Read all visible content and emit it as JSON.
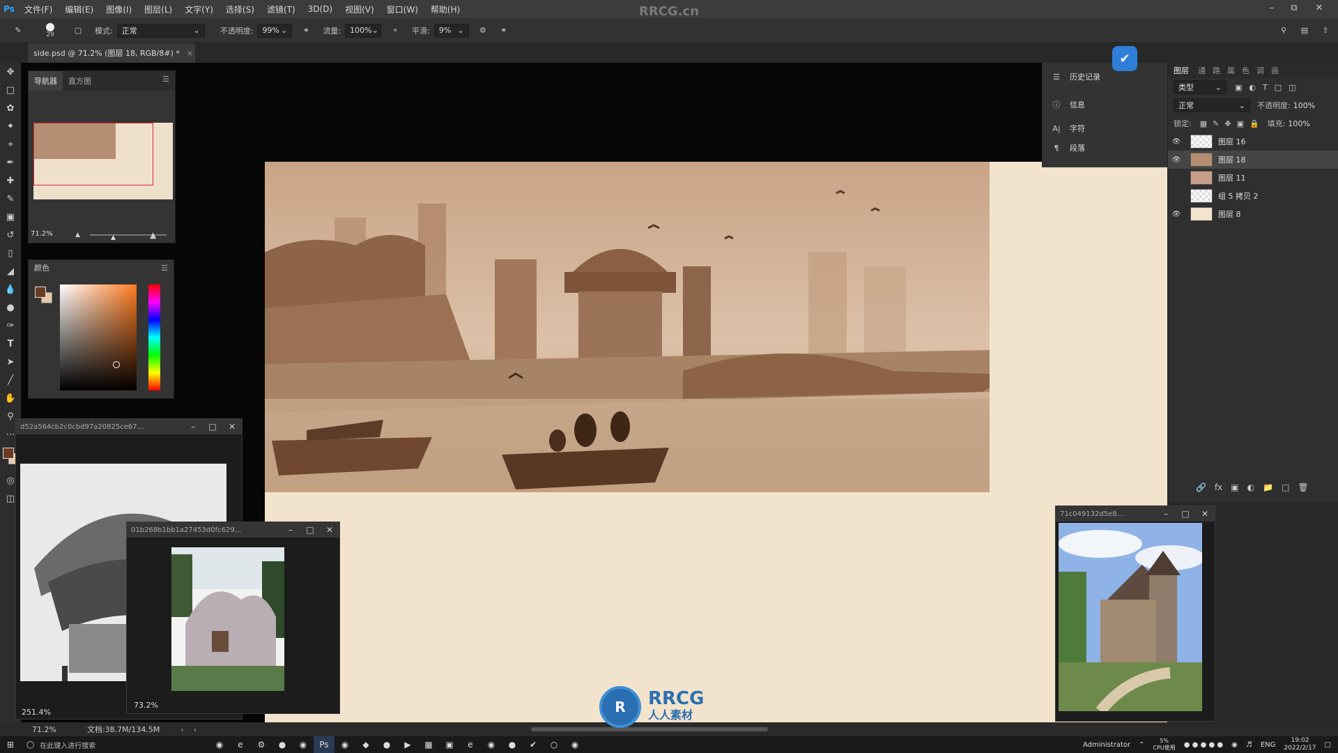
{
  "menubar": {
    "app_icon": "Ps",
    "items": [
      "文件(F)",
      "编辑(E)",
      "图像(I)",
      "图层(L)",
      "文字(Y)",
      "选择(S)",
      "滤镜(T)",
      "3D(D)",
      "视图(V)",
      "窗口(W)",
      "帮助(H)"
    ],
    "watermark_title": "RRCG.cn",
    "window_controls": [
      "minimize-icon",
      "restore-icon",
      "close-icon"
    ]
  },
  "options": {
    "brush_size": "29",
    "mode_label": "模式:",
    "mode_value": "正常",
    "opacity_label": "不透明度:",
    "opacity_value": "99%",
    "flow_label": "流量:",
    "flow_value": "100%",
    "smooth_label": "平滑:",
    "smooth_value": "9%"
  },
  "document": {
    "tab_title": "side.psd @ 71.2% (图层 18, RGB/8#) *"
  },
  "tools": [
    "move-icon",
    "marquee-icon",
    "lasso-icon",
    "magic-wand-icon",
    "crop-icon",
    "eyedropper-icon",
    "healing-icon",
    "brush-icon",
    "stamp-icon",
    "history-brush-icon",
    "eraser-icon",
    "gradient-icon",
    "blur-icon",
    "dodge-icon",
    "pen-icon",
    "type-icon",
    "path-select-icon",
    "line-icon",
    "hand-icon",
    "zoom-icon",
    "more-icon"
  ],
  "navigator": {
    "tab_navigator": "导航器",
    "tab_histogram": "直方图",
    "zoom": "71.2%"
  },
  "color_panel": {
    "title": "颜色",
    "foreground": "#6b3a22",
    "background": "#e8c9a6"
  },
  "ref_windows": {
    "win1_title": "d52a564cb2c0cbd97a20825ce67...",
    "win1_zoom": "251.4%",
    "win2_title": "01b268b1bb1a27453d0fc629...",
    "win2_zoom": "73.2%",
    "win3_title": "71c049132d5e8..."
  },
  "dock": {
    "history": "历史记录",
    "info": "信息",
    "character": "字符",
    "paragraph": "段落"
  },
  "layers": {
    "tabs": [
      "图层",
      "通",
      "路",
      "属",
      "色",
      "调",
      "画"
    ],
    "filter_label": "类型",
    "blend_mode": "正常",
    "opacity_label": "不透明度:",
    "opacity_value": "100%",
    "lock_label": "锁定:",
    "fill_label": "填充:",
    "fill_value": "100%",
    "items": [
      {
        "name": "图层 16",
        "visible": true,
        "selected": false
      },
      {
        "name": "图层 18",
        "visible": true,
        "selected": true
      },
      {
        "name": "图层 11",
        "visible": false,
        "selected": false
      },
      {
        "name": "组 5 拷贝 2",
        "visible": false,
        "selected": false
      },
      {
        "name": "图层 8",
        "visible": true,
        "selected": false
      }
    ],
    "bottom_fx": "fx"
  },
  "status": {
    "zoom": "71.2%",
    "doc_size": "文档:38.7M/134.5M"
  },
  "taskbar": {
    "search_placeholder": "在此键入进行搜索",
    "user": "Administrator",
    "cpu_value": "5%",
    "cpu_label": "CPU使用",
    "lang": "ENG",
    "time": "19:02",
    "date": "2022/2/17"
  },
  "watermark": {
    "brand": "RRCG",
    "brand_cn": "人人素材"
  },
  "colors": {
    "canvas_paper": "#f2e3cd",
    "sepia_dark": "#6e4630",
    "sepia_mid": "#a27f62",
    "sepia_light": "#cdb29b"
  }
}
